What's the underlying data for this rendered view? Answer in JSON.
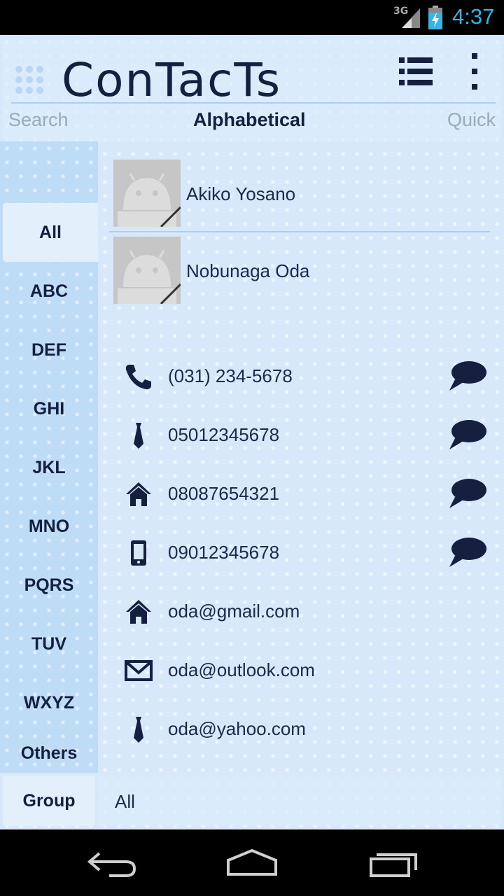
{
  "status_bar": {
    "network": "3G",
    "time": "4:37",
    "icons": [
      "signal-icon",
      "battery-charging-icon"
    ]
  },
  "header": {
    "app_title": "ConTacTs",
    "icons": [
      "grid-icon",
      "list-view-icon",
      "overflow-menu-icon"
    ]
  },
  "tabs": [
    {
      "label": "Search"
    },
    {
      "label": "Alphabetical"
    },
    {
      "label": "Quick"
    }
  ],
  "sidebar": {
    "items": [
      {
        "label": "All"
      },
      {
        "label": "ABC"
      },
      {
        "label": "DEF"
      },
      {
        "label": "GHI"
      },
      {
        "label": "JKL"
      },
      {
        "label": "MNO"
      },
      {
        "label": "PQRS"
      },
      {
        "label": "TUV"
      },
      {
        "label": "WXYZ"
      },
      {
        "label": "Others"
      }
    ],
    "active": "All"
  },
  "contacts": [
    {
      "name": "Akiko Yosano"
    },
    {
      "name": "Nobunaga Oda"
    }
  ],
  "details": [
    {
      "icon": "phone-icon",
      "value": "(031) 234-5678",
      "sms": true
    },
    {
      "icon": "tie-work-icon",
      "value": "05012345678",
      "sms": true
    },
    {
      "icon": "home-icon",
      "value": "08087654321",
      "sms": true
    },
    {
      "icon": "mobile-phone-icon",
      "value": "09012345678",
      "sms": true
    },
    {
      "icon": "home-icon",
      "value": "oda@gmail.com",
      "sms": false
    },
    {
      "icon": "envelope-icon",
      "value": "oda@outlook.com",
      "sms": false
    },
    {
      "icon": "tie-work-icon",
      "value": "oda@yahoo.com",
      "sms": false
    }
  ],
  "footer": {
    "group_label": "Group",
    "group_value": "All"
  },
  "colors": {
    "background": "#d6e8fa",
    "sidebar": "#bfdcf6",
    "text": "#152040",
    "accent_clock": "#33b5e5",
    "divider": "#a9d0ee"
  }
}
